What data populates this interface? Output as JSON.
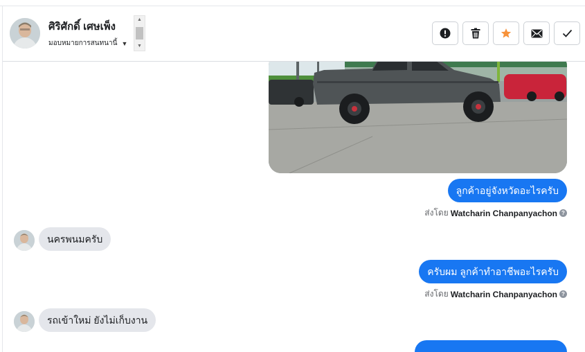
{
  "header": {
    "contact_name": "ศิริศักดิ์ เศษเพ็ง",
    "assign_label": "มอบหมายการสนทนานี้",
    "actions": [
      {
        "name": "mark-spam-button",
        "icon": "exclamation-circle-icon"
      },
      {
        "name": "delete-button",
        "icon": "trash-icon"
      },
      {
        "name": "star-button",
        "icon": "star-icon",
        "color": "#f7923a"
      },
      {
        "name": "mark-unread-button",
        "icon": "envelope-icon"
      },
      {
        "name": "mark-done-button",
        "icon": "checkmark-icon"
      }
    ]
  },
  "messages": [
    {
      "type": "image",
      "direction": "outgoing",
      "content": "photo of grey pickup truck in car lot"
    },
    {
      "type": "text",
      "direction": "outgoing",
      "text": "ลูกค้าอยู่จังหวัดอะไรครับ",
      "sent_by_prefix": "ส่งโดย",
      "sent_by_name": "Watcharin Chanpanyachon"
    },
    {
      "type": "text",
      "direction": "incoming",
      "text": "นครพนมครับ"
    },
    {
      "type": "text",
      "direction": "outgoing",
      "text": "ครับผม ลูกค้าทำอาชีพอะไรครับ",
      "sent_by_prefix": "ส่งโดย",
      "sent_by_name": "Watcharin Chanpanyachon"
    },
    {
      "type": "text",
      "direction": "incoming",
      "text": "รถเข้าใหม่ ยังไม่เก็บงาน"
    },
    {
      "type": "text",
      "direction": "outgoing",
      "text": ""
    }
  ],
  "colors": {
    "outgoing_bubble": "#1877f2",
    "incoming_bubble": "#e4e6eb",
    "star": "#f7923a"
  }
}
